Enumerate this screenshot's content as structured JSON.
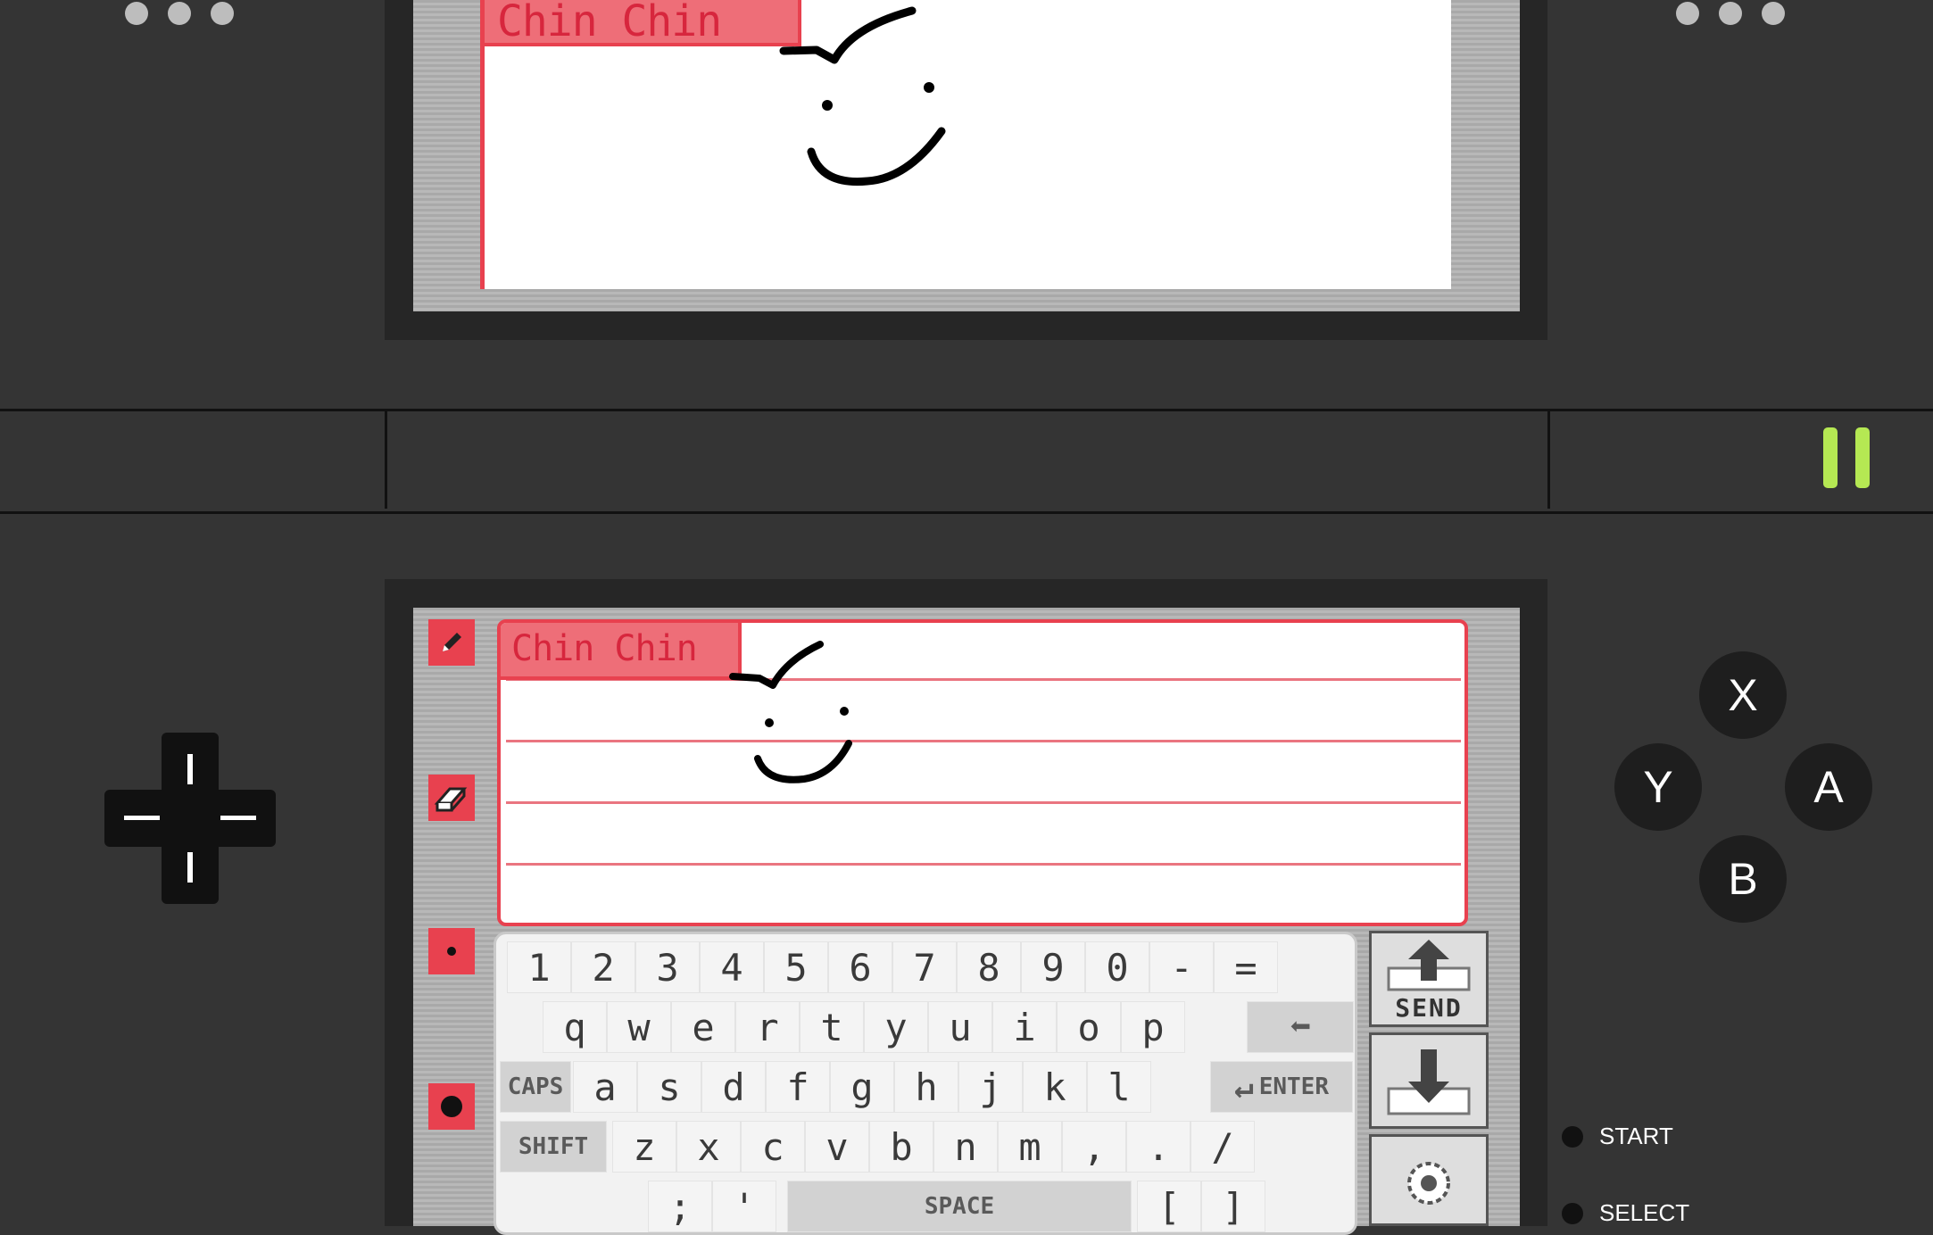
{
  "top_screen": {
    "note_title": "Chin Chin"
  },
  "bottom_screen": {
    "note_title": "Chin Chin"
  },
  "tools": [
    "pencil-icon",
    "eraser-icon",
    "small-pen-icon",
    "large-pen-icon"
  ],
  "keyboard": {
    "row1": [
      "1",
      "2",
      "3",
      "4",
      "5",
      "6",
      "7",
      "8",
      "9",
      "0",
      "-",
      "="
    ],
    "row2": [
      "q",
      "w",
      "e",
      "r",
      "t",
      "y",
      "u",
      "i",
      "o",
      "p"
    ],
    "row3": [
      "a",
      "s",
      "d",
      "f",
      "g",
      "h",
      "j",
      "k",
      "l"
    ],
    "row4": [
      "z",
      "x",
      "c",
      "v",
      "b",
      "n",
      "m",
      ",",
      ".",
      "/"
    ],
    "row5": [
      ";",
      "'"
    ],
    "caps": "CAPS",
    "shift": "SHIFT",
    "enter": "ENTER",
    "space": "SPACE",
    "bracket_open": "[",
    "bracket_close": "]",
    "send": "SEND"
  },
  "buttons": {
    "x": "X",
    "y": "Y",
    "a": "A",
    "b": "B",
    "start": "START",
    "select": "SELECT"
  },
  "colors": {
    "accent_red": "#e8414f",
    "pause_green": "#b5e853",
    "background": "#343434"
  }
}
